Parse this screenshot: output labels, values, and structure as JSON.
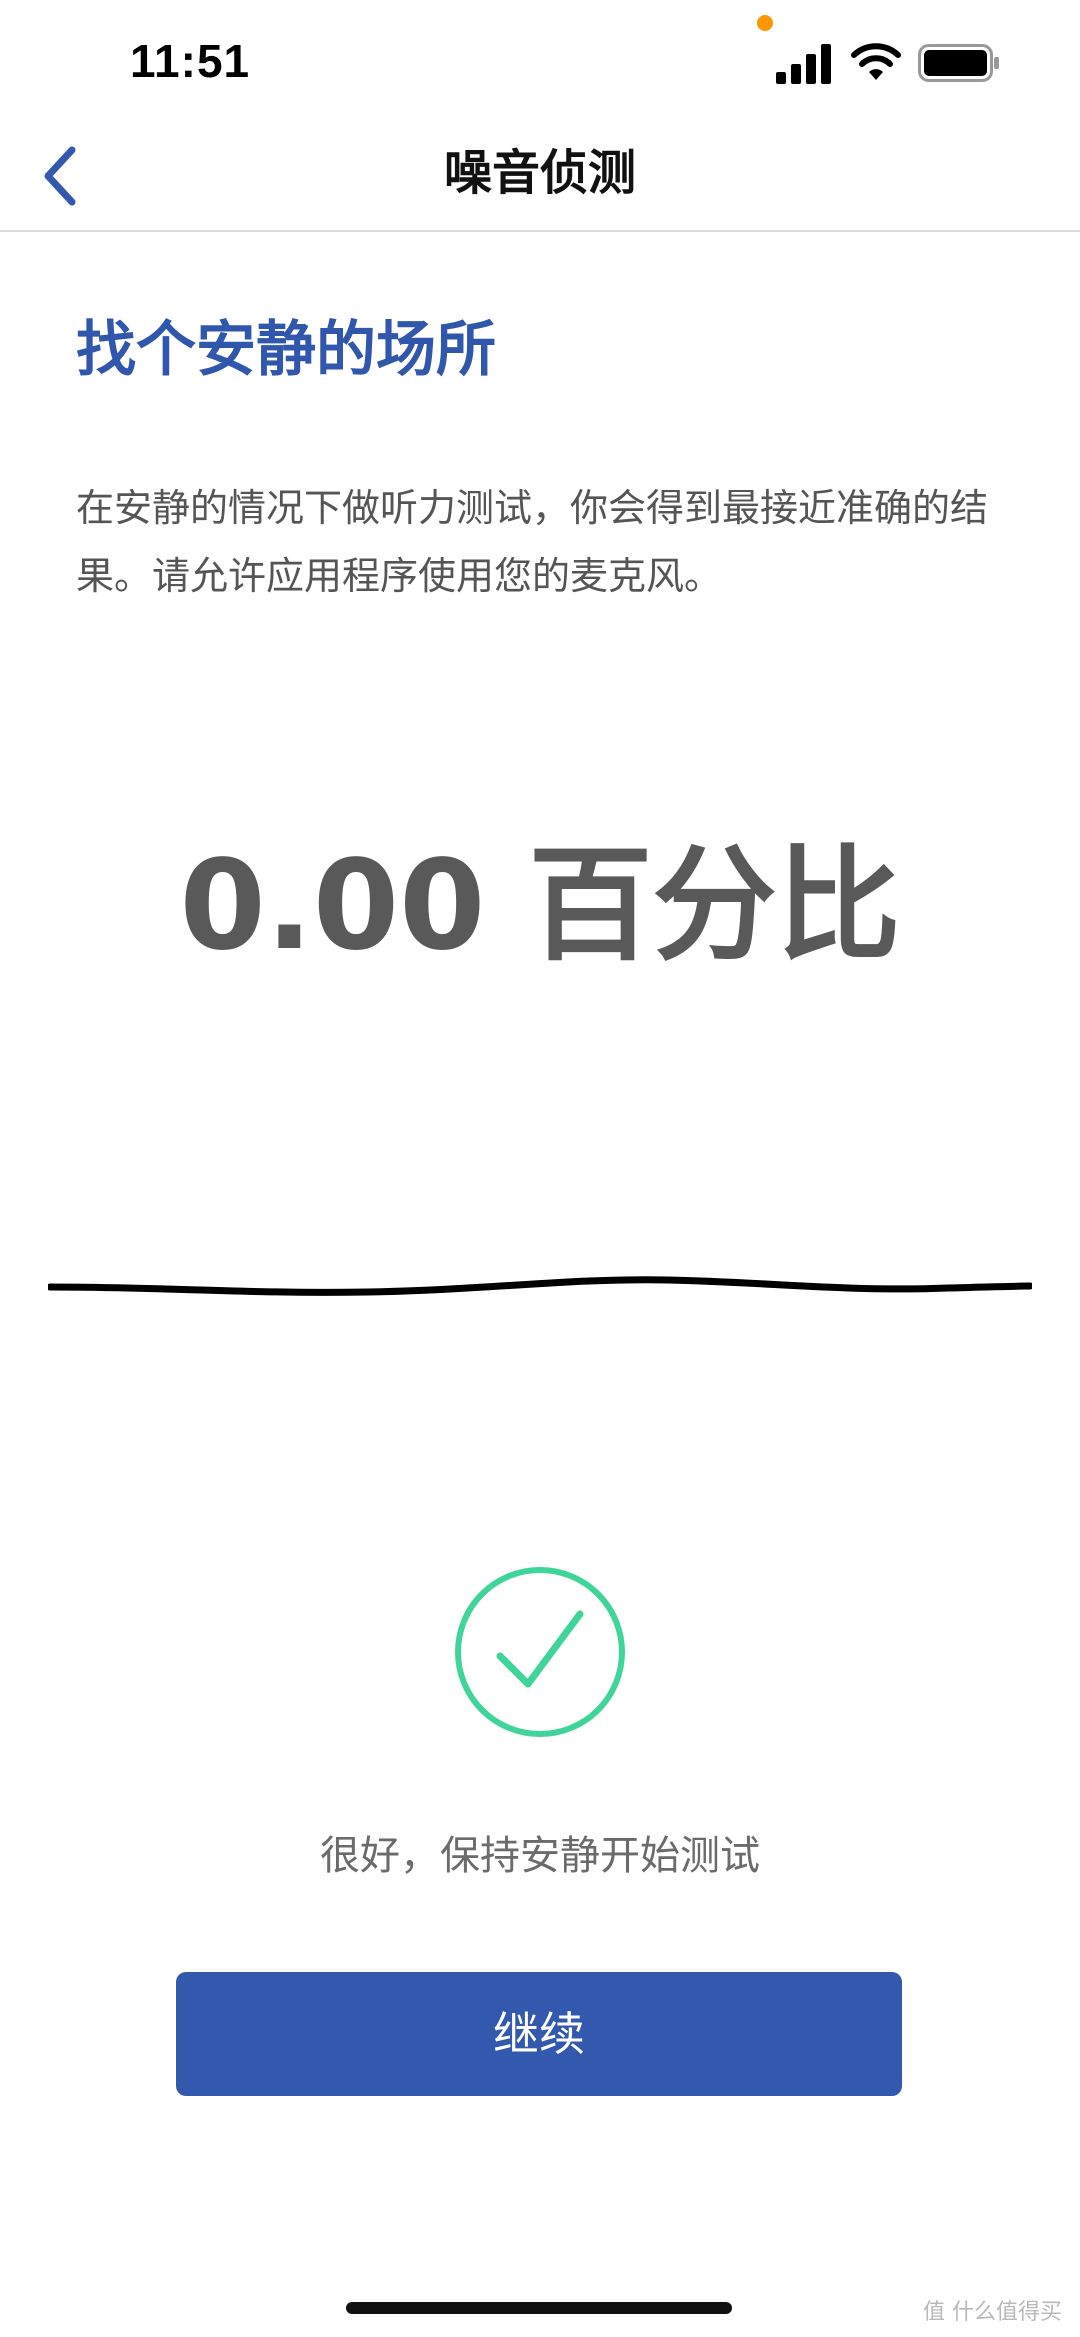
{
  "status_bar": {
    "time": "11:51",
    "icons": [
      "signal-icon",
      "wifi-icon",
      "battery-icon"
    ],
    "mic_indicator_color": "#ff9500"
  },
  "nav": {
    "title": "噪音侦测",
    "back_icon": "chevron-left-icon"
  },
  "content": {
    "headline": "找个安静的场所",
    "description": "在安静的情况下做听力测试，你会得到最接近准确的结果。请允许应用程序使用您的麦克风。",
    "noise_value": "0.00 百分比",
    "status_icon": "check-circle-icon",
    "status_message": "很好，保持安静开始测试"
  },
  "actions": {
    "continue_label": "继续"
  },
  "watermark": "值 什么值得买",
  "colors": {
    "accent": "#3259ae",
    "headline": "#3157ad",
    "success": "#3fd49a",
    "text_secondary": "#555555"
  }
}
